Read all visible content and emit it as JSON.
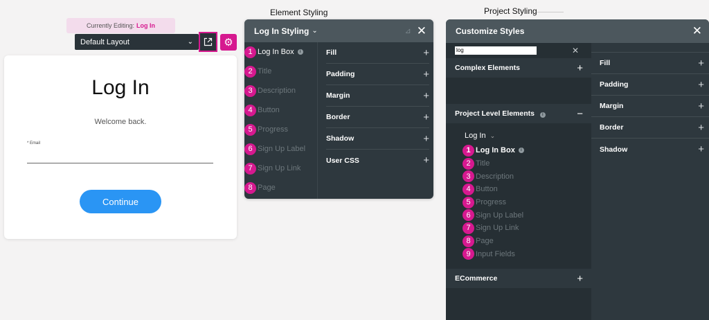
{
  "editor": {
    "currently_editing_label": "Currently Editing:",
    "currently_editing_value": "Log In",
    "layout_select": "Default Layout",
    "layout_chevron": "⌄",
    "gear_glyph": "⚙"
  },
  "login_card": {
    "title": "Log In",
    "description": "Welcome back.",
    "email_label": "* Email",
    "continue_label": "Continue"
  },
  "captions": {
    "element_styling": "Element Styling",
    "project_styling": "Project Styling"
  },
  "element_styling": {
    "title": "Log In Styling",
    "title_chevron": "⌄",
    "pin_glyph": "⊿",
    "close_glyph": "✕",
    "items": [
      {
        "num": "1",
        "label": "Log In Box",
        "info": "i"
      },
      {
        "num": "2",
        "label": "Title"
      },
      {
        "num": "3",
        "label": "Description"
      },
      {
        "num": "4",
        "label": "Button"
      },
      {
        "num": "5",
        "label": "Progress"
      },
      {
        "num": "6",
        "label": "Sign Up Label"
      },
      {
        "num": "7",
        "label": "Sign Up Link"
      },
      {
        "num": "8",
        "label": "Page"
      }
    ],
    "properties": [
      "Fill",
      "Padding",
      "Margin",
      "Border",
      "Shadow",
      "User CSS"
    ],
    "plus_glyph": "+"
  },
  "customize_styles": {
    "title": "Customize Styles",
    "close_glyph": "✕",
    "search_value": "log",
    "search_clear": "✕",
    "sections": {
      "complex": "Complex Elements",
      "project": "Project Level Elements",
      "project_info": "i",
      "ecommerce": "ECommerce"
    },
    "plus_glyph": "+",
    "minus_glyph": "−",
    "group_label": "Log In",
    "group_chevron": "⌄",
    "items": [
      {
        "num": "1",
        "label": "Log In Box",
        "info": "i"
      },
      {
        "num": "2",
        "label": "Title"
      },
      {
        "num": "3",
        "label": "Description"
      },
      {
        "num": "4",
        "label": "Button"
      },
      {
        "num": "5",
        "label": "Progress"
      },
      {
        "num": "6",
        "label": "Sign Up Label"
      },
      {
        "num": "7",
        "label": "Sign Up Link"
      },
      {
        "num": "8",
        "label": "Page"
      },
      {
        "num": "9",
        "label": "Input Fields"
      }
    ],
    "properties": [
      "Fill",
      "Padding",
      "Margin",
      "Border",
      "Shadow"
    ]
  },
  "colors": {
    "accent": "#d6198f",
    "panel": "#2e383e",
    "panel_header": "#4c575d",
    "button": "#2a95f4"
  }
}
